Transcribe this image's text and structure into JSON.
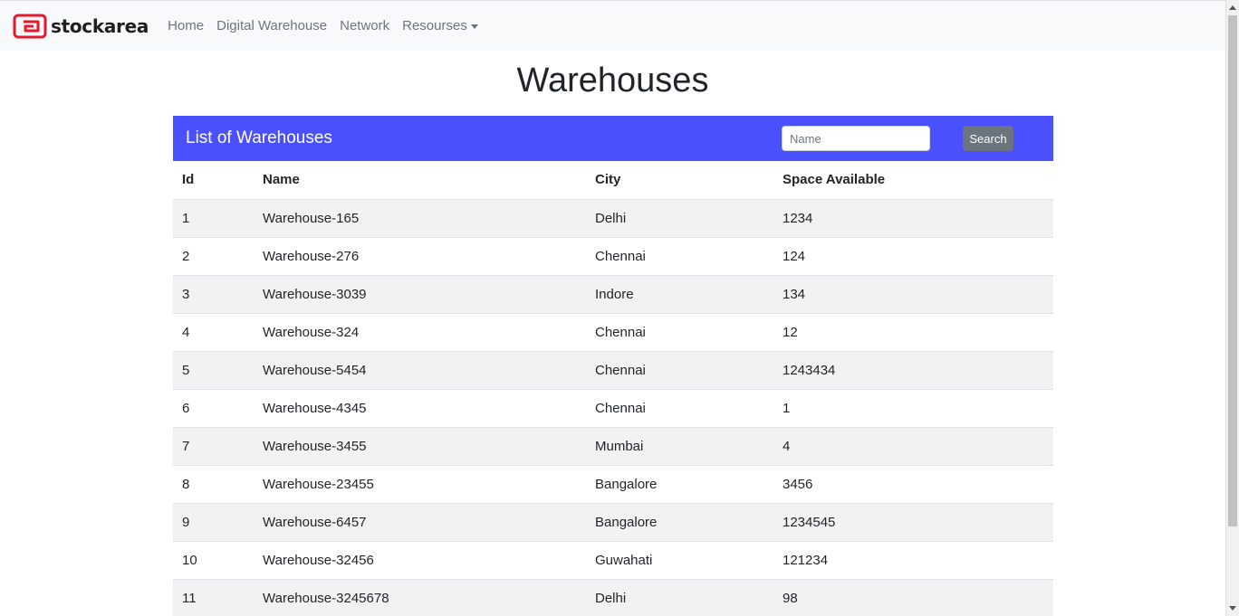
{
  "nav": {
    "brand": "stockarea",
    "links": [
      "Home",
      "Digital Warehouse",
      "Network",
      "Resourses"
    ]
  },
  "page": {
    "title": "Warehouses"
  },
  "card": {
    "title": "List of Warehouses",
    "search_placeholder": "Name",
    "search_button": "Search"
  },
  "table": {
    "headers": [
      "Id",
      "Name",
      "City",
      "Space Available"
    ],
    "rows": [
      [
        "1",
        "Warehouse-165",
        "Delhi",
        "1234"
      ],
      [
        "2",
        "Warehouse-276",
        "Chennai",
        "124"
      ],
      [
        "3",
        "Warehouse-3039",
        "Indore",
        "134"
      ],
      [
        "4",
        "Warehouse-324",
        "Chennai",
        "12"
      ],
      [
        "5",
        "Warehouse-5454",
        "Chennai",
        "1243434"
      ],
      [
        "6",
        "Warehouse-4345",
        "Chennai",
        "1"
      ],
      [
        "7",
        "Warehouse-3455",
        "Mumbai",
        "4"
      ],
      [
        "8",
        "Warehouse-23455",
        "Bangalore",
        "3456"
      ],
      [
        "9",
        "Warehouse-6457",
        "Bangalore",
        "1234545"
      ],
      [
        "10",
        "Warehouse-32456",
        "Guwahati",
        "121234"
      ],
      [
        "11",
        "Warehouse-3245678",
        "Delhi",
        "98"
      ]
    ]
  },
  "colors": {
    "header_blue": "#4b50ff",
    "logo_red": "#e5182c",
    "button_gray": "#6c757d"
  }
}
